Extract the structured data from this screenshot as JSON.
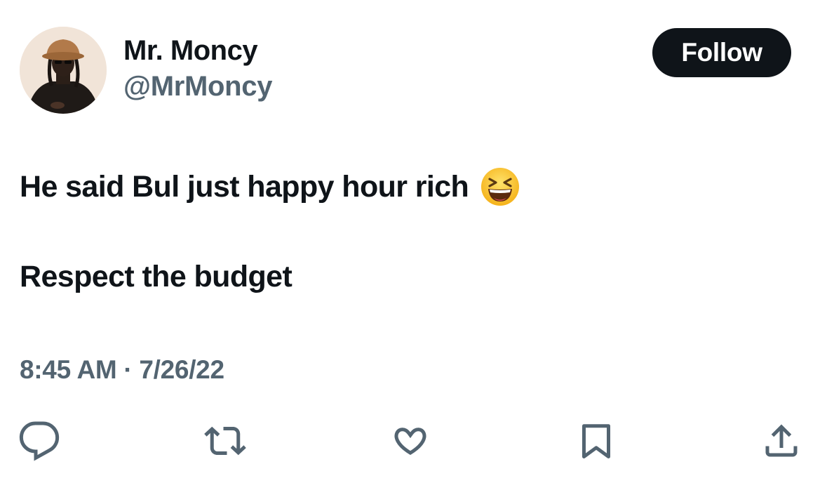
{
  "author": {
    "display_name": "Mr. Moncy",
    "handle": "@MrMoncy"
  },
  "follow_button": {
    "label": "Follow"
  },
  "tweet": {
    "line1": "He said Bul just happy hour rich",
    "emoji": "grinning-squinting-face",
    "line2": "Respect the budget"
  },
  "timestamp": "8:45 AM · 7/26/22",
  "actions": [
    {
      "name": "reply",
      "icon": "speech-bubble-icon"
    },
    {
      "name": "retweet",
      "icon": "retweet-icon"
    },
    {
      "name": "like",
      "icon": "heart-icon"
    },
    {
      "name": "bookmark",
      "icon": "bookmark-icon"
    },
    {
      "name": "share",
      "icon": "share-icon"
    }
  ],
  "colors": {
    "text_primary": "#0f1419",
    "text_secondary": "#536471",
    "button_bg": "#0f1419",
    "button_text": "#ffffff",
    "background": "#ffffff"
  }
}
